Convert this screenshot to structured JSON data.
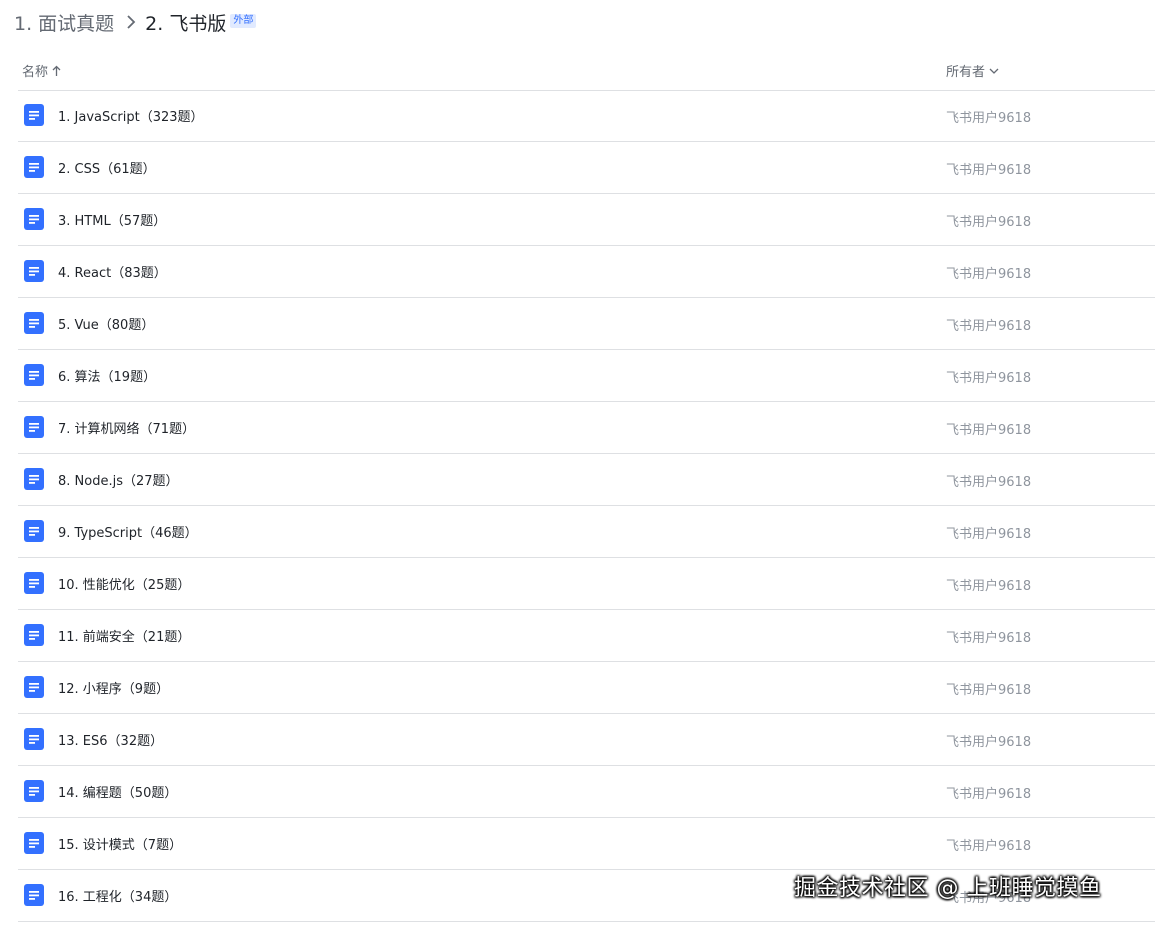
{
  "breadcrumb": {
    "parent": "1. 面试真题",
    "current": "2. 飞书版",
    "badge": "外部"
  },
  "table": {
    "headers": {
      "name": "名称",
      "owner": "所有者"
    },
    "rows": [
      {
        "name": "1. JavaScript（323题）",
        "owner": "飞书用户9618"
      },
      {
        "name": "2. CSS（61题）",
        "owner": "飞书用户9618"
      },
      {
        "name": "3. HTML（57题）",
        "owner": "飞书用户9618"
      },
      {
        "name": "4. React（83题）",
        "owner": "飞书用户9618"
      },
      {
        "name": "5. Vue（80题）",
        "owner": "飞书用户9618"
      },
      {
        "name": "6. 算法（19题）",
        "owner": "飞书用户9618"
      },
      {
        "name": "7. 计算机网络（71题）",
        "owner": "飞书用户9618"
      },
      {
        "name": "8. Node.js（27题）",
        "owner": "飞书用户9618"
      },
      {
        "name": "9. TypeScript（46题）",
        "owner": "飞书用户9618"
      },
      {
        "name": "10. 性能优化（25题）",
        "owner": "飞书用户9618"
      },
      {
        "name": "11. 前端安全（21题）",
        "owner": "飞书用户9618"
      },
      {
        "name": "12. 小程序（9题）",
        "owner": "飞书用户9618"
      },
      {
        "name": "13. ES6（32题）",
        "owner": "飞书用户9618"
      },
      {
        "name": "14. 编程题（50题）",
        "owner": "飞书用户9618"
      },
      {
        "name": "15. 设计模式（7题）",
        "owner": "飞书用户9618"
      },
      {
        "name": "16. 工程化（34题）",
        "owner": "飞书用户9618"
      }
    ]
  },
  "watermark": "掘金技术社区 @ 上班睡觉摸鱼",
  "colors": {
    "doc_icon": "#3370ff",
    "divider": "#dee0e3",
    "text_primary": "#1f2329",
    "text_secondary": "#646a73",
    "badge_bg": "#e1eaff"
  },
  "icons": {
    "breadcrumb_separator": "chevron-right-icon",
    "sort": "arrow-up-icon",
    "owner_filter": "chevron-down-icon",
    "doc": "document-icon"
  }
}
